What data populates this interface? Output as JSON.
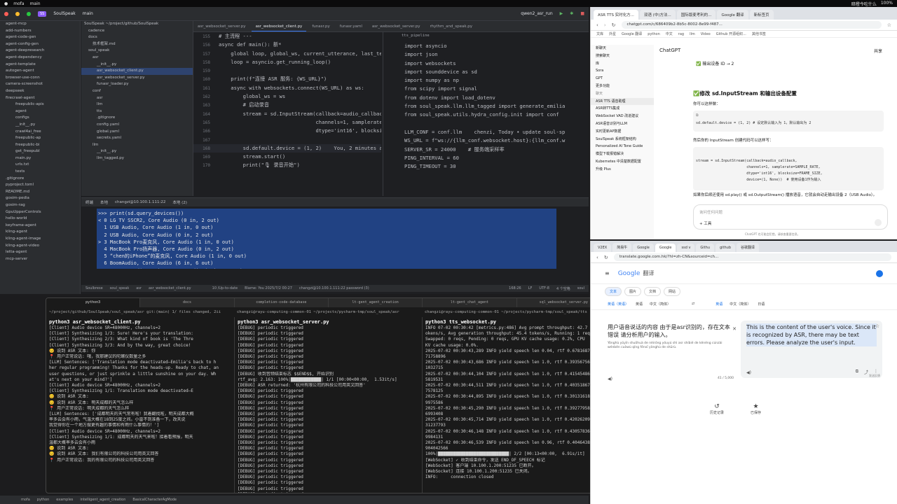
{
  "menubar": {
    "app": "mofa",
    "branch": "main",
    "items": [
      "暗橙今吃什么",
      "100%"
    ]
  },
  "ide": {
    "project": "SoulSpeak",
    "branch": "main",
    "run_config": "qwen2_asr_run",
    "left_tree": [
      "agent-mcp",
      "add-numbers",
      "agent-code-gen",
      "agent-config-gen",
      "agent-deepresearch",
      "agent-dependency",
      "agent-template",
      "autogen-agent",
      "browser-use-conn",
      "camera-screenshot",
      "deepseek",
      "firecrawl-agent",
      "freepublic-apis",
      "agent",
      "configs",
      "__init__.py",
      "crawl4ai_free",
      "freepublic-ap",
      "freepublic-bi",
      "get_freepubl",
      "main.py",
      "urls.txt",
      "tests",
      ".gitignore",
      "pyproject.toml",
      "README.md",
      "gosim-pedia",
      "gosim-rag",
      "GpuUpperControls",
      "hello-world",
      "keyframe-agent",
      "kling-agent",
      "kling-agent-image",
      "kling-agent-video",
      "letta-agent",
      "mcp-server"
    ],
    "tree": [
      "SoulSpeak ~/project/github/SoulSpeak",
      "cadence",
      "docs",
      "技术框架.md",
      "soul_speak",
      "asr",
      "__init__.py",
      "asr_websocket_client.py",
      "asr_websocket_server.py",
      "funasr_loader.py",
      "conf",
      "asr",
      "llm",
      "tts",
      ".gitignore",
      "config.yaml",
      "global.yaml",
      "secrets.yaml",
      "llm",
      "__init__.py",
      "llm_tagged.py"
    ],
    "tree_selected": 7,
    "tabs": [
      "asr_websocket_server.py",
      "asr_websocket_client.py",
      "funasr.py",
      "funasr.yaml",
      "asr_websocket_server.py",
      "rhythm_and_speak.py"
    ],
    "active_tab": 1,
    "left_lines": [
      {
        "n": "155",
        "t": "# 主流程 ---"
      },
      {
        "n": "156",
        "t": "async def main(): 新*"
      },
      {
        "n": "157",
        "t": "    global loop, global_ws, current_utterance, last_text_"
      },
      {
        "n": "158",
        "t": "    loop = asyncio.get_running_loop()"
      },
      {
        "n": "159",
        "t": ""
      },
      {
        "n": "160",
        "t": "    print(f\"连接 ASR 服务: {WS_URL}\")"
      },
      {
        "n": "161",
        "t": "    async with websockets.connect(WS_URL) as ws:"
      },
      {
        "n": "162",
        "t": "        global_ws = ws"
      },
      {
        "n": "163",
        "t": "        # 启动录音"
      },
      {
        "n": "164",
        "t": "        stream = sd.InputStream(callback=audio_callback,"
      },
      {
        "n": "165",
        "t": "                                channels=1, samplerate=SA"
      },
      {
        "n": "166",
        "t": "                                dtype='int16', blocksize="
      },
      {
        "n": "167",
        "t": ""
      },
      {
        "n": "168",
        "t": "        sd.default.device = (1, 2)    You, 2 minutes ago"
      },
      {
        "n": "169",
        "t": "        stream.start()"
      },
      {
        "n": "170",
        "t": "        print(\"🎙 录音开始\")"
      }
    ],
    "right_file": "tts_pipeline",
    "right_lines": [
      "import asyncio",
      "import json",
      "import websockets",
      "import sounddevice as sd",
      "import numpy as np",
      "from scipy import signal",
      "from dotenv import load_dotenv",
      "from soul_speak.llm.llm_tagged import generate_emilia",
      "from soul_speak.utils.hydra_config.init import conf",
      "",
      "LLM_CONF = conf.llm    chenzi, Today • update soul-sp",
      "WS_URL = f\"ws://{llm_conf.websocket.host}:{llm_conf.w",
      "SERVER_SR = 24000    # 服务端采样率",
      "PING_INTERVAL = 60",
      "PING_TIMEOUT = 30"
    ],
    "terminal_tabs": [
      "终端",
      "本地",
      "changzi@10.100.1.111:22",
      "本地 (2)"
    ],
    "terminal_lines": [
      ">>> print(sd.query_devices())",
      "< 0 LG TV SSCR2, Core Audio (0 in, 2 out)",
      "  1 USB Audio, Core Audio (1 in, 0 out)",
      "  2 USB Audio, Core Audio (0 in, 2 out)",
      "> 3 MacBook Pro麦克风, Core Audio (1 in, 0 out)",
      "  4 MacBook Pro扬声器, Core Audio (0 in, 2 out)",
      "  5 “chen的iPhone”的麦克风, Core Audio (1 in, 0 out)",
      "  6 BoomAudio, Core Audio (6 in, 6 out)",
      "  7 WeMeet Audio Device, Core Audio (2 in, 2 out)"
    ],
    "status": [
      "Soulbrese",
      "soul_speak",
      "asr",
      "asr_websocket_client.py",
      "10 /Up-to-date",
      "Blame: You 2025/7/2 00:27",
      "changzi@10.100.1.111:22 password (3)",
      "168:26",
      "LF",
      "UTF-8",
      "4 个空格",
      "soul"
    ]
  },
  "terminal": {
    "tabs": [
      "python3",
      "docs",
      "completion-code-database",
      "lt-gent_agent_creation",
      "lt-gent_chat_agent",
      "sql_websocket_server.py"
    ],
    "panes": [
      {
        "title": "~/project/github/SoulSpeak/soul_speak/asr git:(main)  1/ files changed, 2ii",
        "header": "python3 asr_websocket_client.py",
        "lines": [
          "[Client] Audio device SR=48000Hz, channels=2",
          "[Client] Synthesizing 1/3: Sure! Here's your translation:",
          "[Client] Synthesizing 2/3: What kind of book is 'The Thre",
          "[Client] Synthesizing 3/3: And by the way, great choice!",
          "😊 说到 ASR 文本: 你",
          "📍 用户正常说话: 哦，我那建议的陀螺仪数量之多",
          "[LLM] Sentences: ['Translation mode deactivated—Emilia's back to h",
          "her regular programming! Thanks for the heads-up. Ready to chat, an",
          "user questions, or just sprinkle a little sunshine on your day. Wh",
          "at's next on your mind?']",
          "[Client] Audio device SR=48000Hz, channels=2",
          "[Client] Synthesizing 1/1: Translation mode deactivated—E",
          "😊 说到 ASR 文本: ",
          "😊 说到 ASR 文本: 明天成都的天气怎么样",
          "📍 用户正常说话: 明天成都的天气怎么样",
          "[LLM] Sentences: ['成都明天的天气常有啦！我着翻找啦，明天成都大概",
          "率多云会有小雨，气温大概在18到25度之间。小雷不到准备一下，改天说",
          "我觉得你在一个地方做更有趣的事情和有雨什么事情的！']",
          "[Client] Audio device SR=48000Hz, channels=2",
          "[Client] Synthesizing 1/1: 成都明天的天气来啦！接着看预报，明天",
          "温都大概率多云会有小雨",
          "😊 说到 ASR 文本: ",
          "😊 说到 ASR 文本: 我们有限公司的科技公司用英文回答",
          "📍 用户正常说话: 我的有限公司的科技公司用英文回答"
        ]
      },
      {
        "title": "changzi@rayu-computing-common-01 ~/projects/pycharm-tmp/soul_speak/asr",
        "header": "python3 asr_websocket_server.py",
        "lines": [
          "[DEBUG] periodic triggered",
          "[DEBUG] periodic triggered",
          "[DEBUG] periodic triggered",
          "[DEBUG] periodic triggered",
          "[DEBUG] periodic triggered",
          "[DEBUG] periodic triggered",
          "[DEBUG] periodic triggered",
          "[DEBUG] periodic triggered",
          "[DEBUG] 收到音频结束标志 $$END$$, 开始识别",
          "rtf_avg: 2.163: 100%|████████████| 1/1 [00:00<00:00,  1.53it/s]",
          "[DEBUG] ASR returned: '杭州有限公司的科技公司用英文回答'",
          "[DEBUG] periodic triggered",
          "[DEBUG] periodic triggered",
          "[DEBUG] periodic triggered",
          "[DEBUG] periodic triggered",
          "[DEBUG] periodic triggered",
          "[DEBUG] periodic triggered",
          "[DEBUG] periodic triggered",
          "[DEBUG] periodic triggered",
          "[DEBUG] periodic triggered",
          "[DEBUG] periodic triggered",
          "[DEBUG] periodic triggered",
          "[DEBUG] periodic triggered",
          "[DEBUG] periodic triggered",
          "[DEBUG] periodic triggered",
          "[DEBUG] periodic triggered",
          "[DEBUG] periodic triggered",
          "[DEBUG] periodic triggered",
          "[DEBUG] periodic triggered",
          "[DEBUG] periodic triggered"
        ]
      },
      {
        "title": "changzi@rayu-computing-common-01 ~/projects/pycharm-tmp/soul_speak/tts",
        "header": "python3 tts_websocket.py",
        "lines": [
          "INFO 07-02 00:30:42 [metrics.py:486] Avg prompt throughput: 42.7 t",
          "okens/s, Avg generation throughput: 45.4 tokens/s, Running: 1 reqs",
          "Swapped: 0 reqs, Pending: 0 reqs, GPU KV cache usage: 0.2%, CPU",
          "KV cache usage: 0.0%.",
          "2025-07-02 00:30:43,289 INFO yield speech len 0.04, rtf 0.67816879",
          "71758896",
          "2025-07-02 00:30:43,686 INFO yield speech len 1.0, rtf 0.393567562",
          "1032715",
          "2025-07-02 00:30:44,104 INFO yield speech len 1.0, rtf 0.415454864",
          "5819531",
          "2025-07-02 00:30:44,511 INFO yield speech len 1.0, rtf 0.403518676",
          "7578125",
          "2025-07-02 00:30:44,895 INFO yield speech len 1.0, rtf 0.301316184",
          "9975586",
          "2025-07-02 00:30:45,290 INFO yield speech len 1.0, rtf 0.392779588",
          "6993408",
          "2025-07-02 00:30:45,714 INFO yield speech len 1.0, rtf 0.420262098",
          "31237793",
          "2025-07-02 00:30:46,148 INFO yield speech len 1.0, rtf 0.430578363",
          "9984131",
          "2025-07-02 00:30:46,539 INFO yield speech len 0.96, rtf 0.40464381",
          "904042566",
          "100%|████████████████████████████| 2/2 [00:13<00:00,  6.91s/it]",
          "[WebSocket] ✓ 收到结束命令，发送 END_OF_SPEECH 标记",
          "[WebSocket] 客户端 10.100.1.200:51235 已断开。",
          "[WebSocket] 连接 10.100.1.200:51235 已关闭。",
          "INFO:     connection closed"
        ]
      }
    ]
  },
  "chat": {
    "tabs": [
      "ASR TTS 实时化方...",
      "双语 (中)方法...",
      "国际版麦考利的...",
      "Google 翻译",
      "新标签页"
    ],
    "active_tab": 0,
    "url": "chatgpt.com/c/686409b2-8b5c-8002-8e99-f487...",
    "bookmarks": [
      "文库",
      "外星",
      "Google 翻译",
      "python",
      "中文",
      "rag",
      "llm",
      "Video",
      "Github 开源组织...",
      "其他书签"
    ],
    "model": "ChatGPT",
    "share": "共享",
    "side": [
      "新聊天",
      "搜索聊天",
      "库",
      "Sora",
      "GPT",
      "更多功能",
      "聊天",
      "ASR TTS 语音助理",
      "ASR转TTS集成",
      "WebSocket VAD 改进建议",
      "ASR语音识别与LLM",
      "实时更新AP数据",
      "SoulSpeak 系统框架结构",
      "Personalized AI Tone Guide",
      "模型下载报错解决",
      "Kubernetes 中清楚数据配置",
      "  ",
      "  ",
      "  ",
      "  ",
      "升级 Plus"
    ],
    "side_active": 7,
    "prev": "✅ 输出设备 ID → 2",
    "heading": "✅修改 sd.InputStream 和输出设备配置",
    "p1": "你可以这样做：",
    "code1": "sd.default.device = (1, 2)   # 设定默认输入为 1，默认输出为 2",
    "p2": "然后你的 InputStream 创建代码可以这样写：",
    "code2": [
      "stream = sd.InputStream(callback=audio_callback,",
      "                        channels=1, samplerate=SAMPLE_RATE,",
      "                        dtype='int16', blocksize=FRAME_SIZE,",
      "                        device=(1, None))  # 使用设备1作为输入"
    ],
    "p3": "如果你后续还使用 sd.play() 或 sd.OutputStream() 播放语音，它就会自动走输出设备 2（USB Audio）。",
    "input_ph": "询问任何问题",
    "tools": "工具",
    "footer": "ChatGPT 也可能会犯错。请核查重要信息。"
  },
  "translate": {
    "tabs": [
      "V2EX",
      "简易牛",
      "Google",
      "Google",
      "ssd v",
      "Githu",
      "github",
      "谷歌翻译"
    ],
    "url": "translate.google.com.hk/?hl=zh-CN&sourceid=ch...",
    "logo": "Google",
    "product": "翻译",
    "modes": [
      "文本",
      "图片",
      "文档",
      "网站"
    ],
    "src_langs": [
      "英语（英语）",
      "英语",
      "中文（简体）"
    ],
    "tgt_langs": [
      "英语",
      "中文（简体）",
      "日语"
    ],
    "src_text": "用户语音说话的内容 由于是asr识别的，存在文本错误 请分析用户的输入。",
    "src_pinyin": "Yònghù yǔyīn shuōhuà de nèiróng yóuyú shì asr shíbié de kěnéng cúnzài wénběn cuòwù qǐng fēnxī yònghù de shūrù.",
    "count": "41 / 5,000",
    "tgt_text": "This is the content of the user's voice. Since it is recognized by ASR, there may be text errors. Please analyze the user's input.",
    "feedback": "发送反馈",
    "history": "历史记录",
    "saved": "已保存"
  },
  "dock": [
    "mofa",
    "python",
    "examples",
    "intelligent_agent_creation",
    "BasicalCharacterAgMode"
  ]
}
